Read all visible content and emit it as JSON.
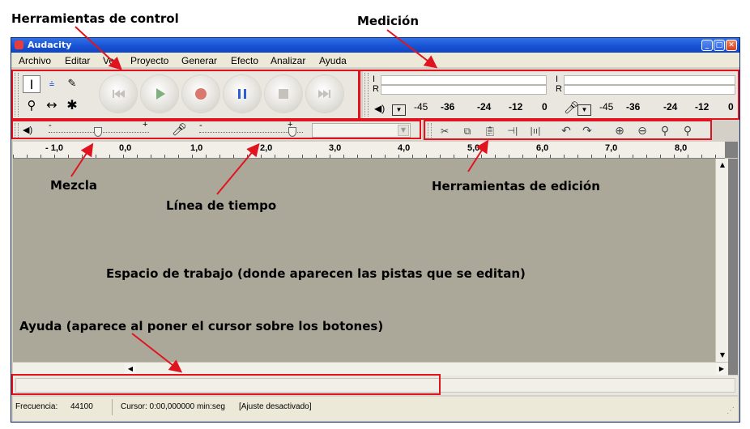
{
  "annotations": {
    "control_tools": "Herramientas de control",
    "meter": "Medición",
    "mixer": "Mezcla",
    "timeline": "Línea de tiempo",
    "edit_tools": "Herramientas de edición",
    "workspace": "Espacio de trabajo (donde aparecen las pistas que se editan)",
    "help": "Ayuda (aparece al poner el cursor sobre los botones)"
  },
  "window": {
    "title": "Audacity"
  },
  "menu": [
    "Archivo",
    "Editar",
    "Ver",
    "Proyecto",
    "Generar",
    "Efecto",
    "Analizar",
    "Ayuda"
  ],
  "meters": {
    "left_label": "I",
    "right_label": "R",
    "ticks": [
      "-45",
      "-36",
      "-24",
      "-12",
      "0"
    ]
  },
  "mixer": {
    "minus": "-",
    "plus": "+"
  },
  "ruler": [
    "- 1,0",
    "0,0",
    "1,0",
    "2,0",
    "3,0",
    "4,0",
    "5,0",
    "6,0",
    "7,0",
    "8,0"
  ],
  "statusbar": {
    "rate_label": "Frecuencia:",
    "rate_value": "44100",
    "cursor_text": "Cursor: 0:00,000000 min:seg",
    "snap_text": "[Ajuste desactivado]"
  },
  "colors": {
    "annotation_box": "#e0141e",
    "workspace": "#aca899",
    "title_blue": "#1a55d6"
  }
}
